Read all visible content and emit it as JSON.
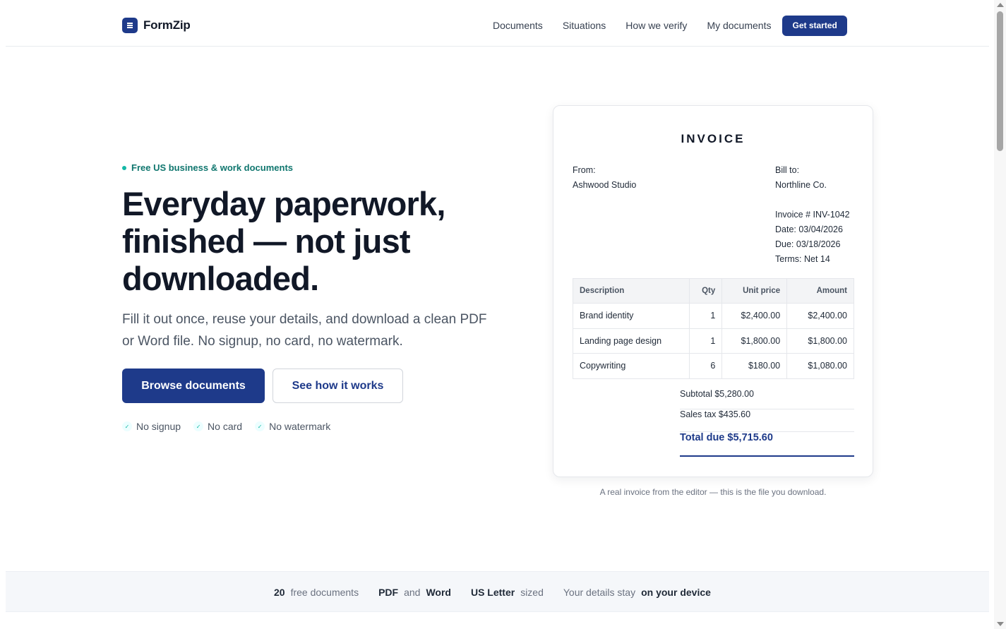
{
  "brand": {
    "name": "FormZip",
    "logo_icon": "document-lines-icon"
  },
  "nav": {
    "items": [
      "Documents",
      "Situations",
      "How we verify",
      "My documents"
    ],
    "cta": "Get started"
  },
  "hero": {
    "badge": "Free US business & work documents",
    "headline_1": "Everyday paperwork,",
    "headline_2": "finished — not just",
    "headline_3": "downloaded.",
    "sub_1": "Fill it out once, reuse your details, and download a clean PDF",
    "sub_2": "or Word file. No signup, no card, no watermark.",
    "primary_button": "Browse documents",
    "secondary_button": "See how it works",
    "checks": [
      "No signup",
      "No card",
      "No watermark"
    ]
  },
  "invoice": {
    "title": "INVOICE",
    "from_label": "From:",
    "from_name": "Ashwood Studio",
    "bill_to_label": "Bill to:",
    "bill_to_name": "Northline Co.",
    "invoice_number": "Invoice # INV-1042",
    "date": "Date: 03/04/2026",
    "due": "Due: 03/18/2026",
    "terms": "Terms: Net 14",
    "columns": [
      "Description",
      "Qty",
      "Unit price",
      "Amount"
    ],
    "rows": [
      [
        "Brand identity",
        "1",
        "$2,400.00",
        "$2,400.00"
      ],
      [
        "Landing page design",
        "1",
        "$1,800.00",
        "$1,800.00"
      ],
      [
        "Copywriting",
        "6",
        "$180.00",
        "$1,080.00"
      ]
    ],
    "subtotal_label": "Subtotal",
    "subtotal": "$5,280.00",
    "tax_label": "Sales tax",
    "tax": "$435.60",
    "total_label": "Total due",
    "total": "$5,715.60",
    "caption": "A real invoice from the editor — this is the file you download."
  },
  "stats": {
    "s1_value": "20",
    "s1_text": "free documents",
    "s2_a": "PDF",
    "s2_and": "and",
    "s2_b": "Word",
    "s3_value": "US Letter",
    "s3_text": "sized",
    "s4_text": "Your details stay",
    "s4_value": "on your device"
  },
  "colors": {
    "primary": "#1e3a8a",
    "accent": "#14b8a6",
    "text": "#111827"
  }
}
